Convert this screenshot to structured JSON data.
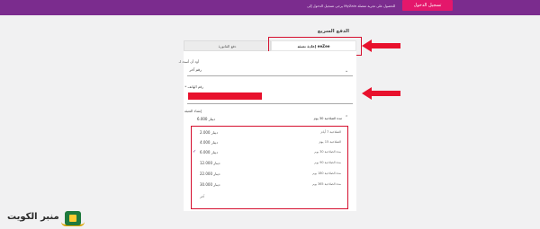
{
  "topbar": {
    "login_label": "تسجيل الدخول",
    "promo_text": "للحصول على تجربة متصلة MyZain يرجى تسجيل الدخول إلى"
  },
  "page": {
    "title": "الدفع السريع"
  },
  "tabs": [
    {
      "label": "دفع الفاتورة"
    },
    {
      "label": "إعادة تعبئة eeZee"
    }
  ],
  "form": {
    "pay_for_label": "أود أن أسدد لـ",
    "pay_for_value": "رقم آخر",
    "phone_label": "رقم الهاتف *",
    "recharge_label": "إنشاء التعبئة",
    "recharge_selected": "مدة الصلاحية 30 يوم",
    "recharge_price": "دينار 6.000"
  },
  "options": [
    {
      "name": "الصلاحية 7 أيام",
      "price": "دينار 2.000",
      "selected": false
    },
    {
      "name": "الصلاحية 15 يوم",
      "price": "دينار 4.000",
      "selected": false
    },
    {
      "name": "مدة الصلاحية 30 يوم",
      "price": "دينار 6.000",
      "selected": true
    },
    {
      "name": "مدة الصلاحية 90 يوم",
      "price": "دينار 12.000",
      "selected": false
    },
    {
      "name": "مدة الصلاحية 180 يوم",
      "price": "دينار 22.000",
      "selected": false
    },
    {
      "name": "مدة الصلاحية 365 يوم",
      "price": "دينار 30.000",
      "selected": false
    },
    {
      "name": "آخر",
      "price": "",
      "selected": false
    }
  ],
  "watermark": {
    "text": "منبر الكويت"
  },
  "colors": {
    "brand_purple": "#7b2c8e",
    "brand_pink": "#e4176b",
    "annotation_red": "#d5102f"
  }
}
